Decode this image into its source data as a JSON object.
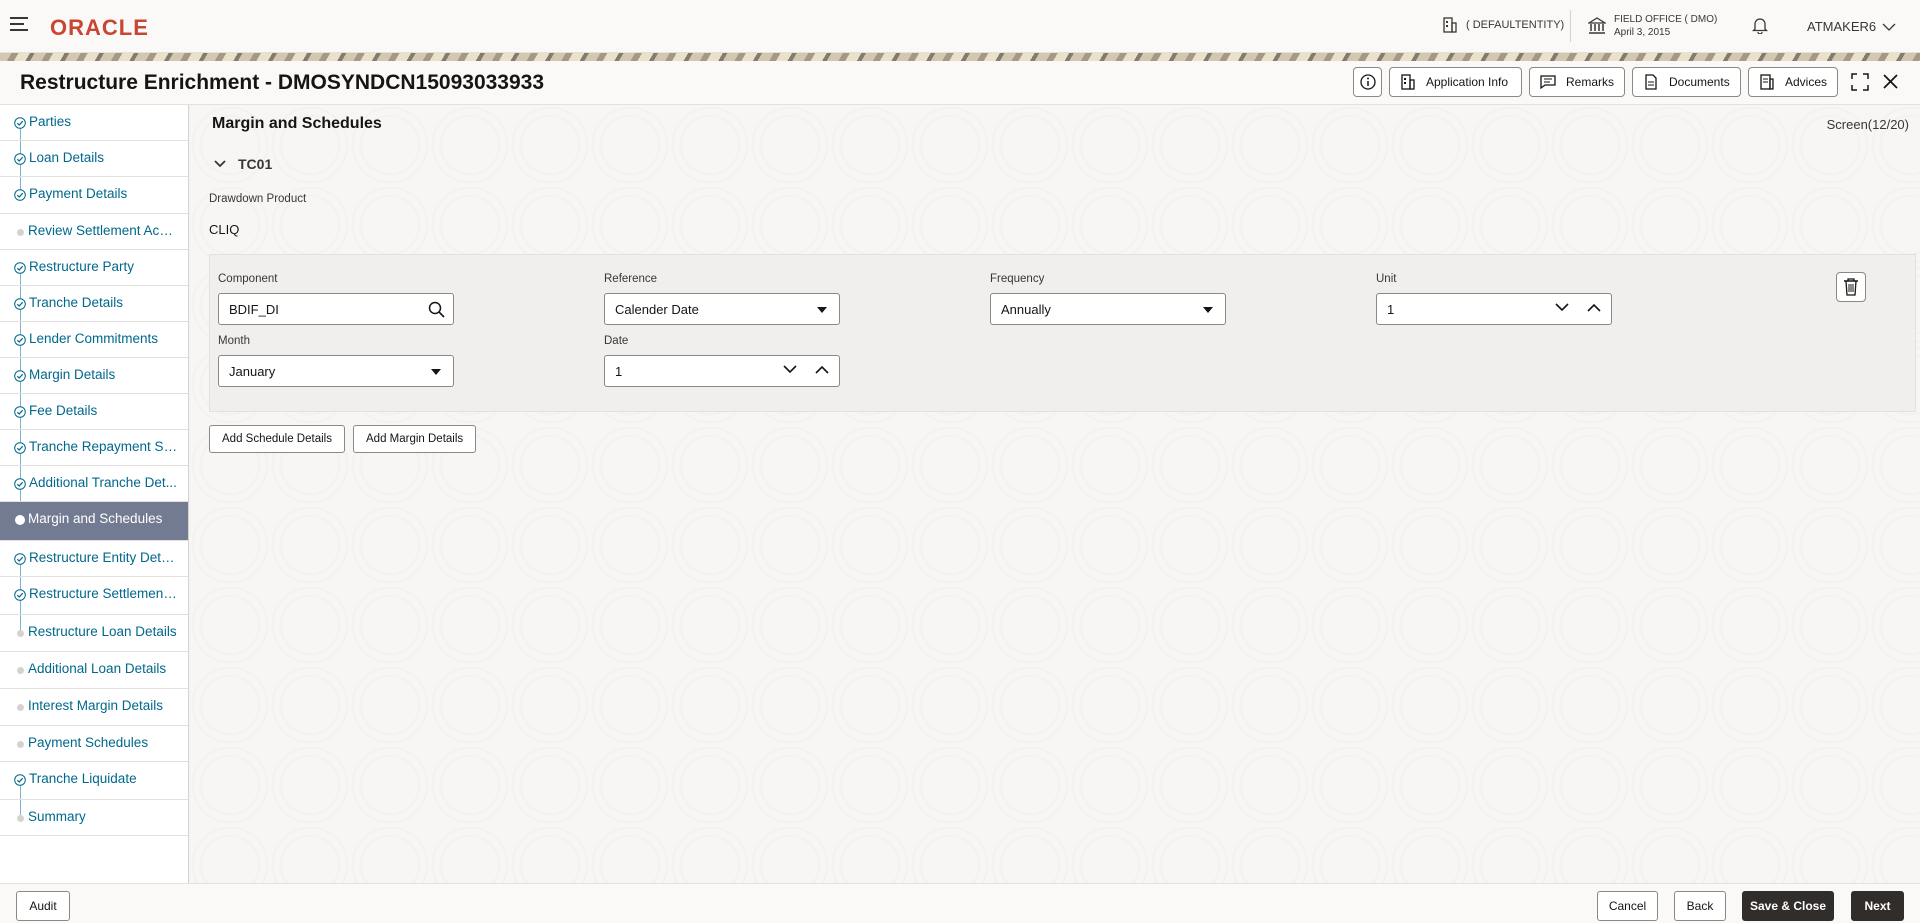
{
  "header": {
    "logo": "ORACLE",
    "entity": "( DEFAULTENTITY)",
    "office_name": "FIELD OFFICE ( DMO)",
    "office_date": "April 3, 2015",
    "user": "ATMAKER6"
  },
  "title": "Restructure Enrichment - DMOSYNDCN15093033933",
  "toolbar": {
    "application_info": "Application Info",
    "remarks": "Remarks",
    "documents": "Documents",
    "advices": "Advices"
  },
  "sidebar": {
    "items": [
      {
        "label": "Parties",
        "state": "done"
      },
      {
        "label": "Loan Details",
        "state": "done"
      },
      {
        "label": "Payment Details",
        "state": "done"
      },
      {
        "label": "Review Settlement Acco...",
        "state": "pending"
      },
      {
        "label": "Restructure Party",
        "state": "done"
      },
      {
        "label": "Tranche Details",
        "state": "done"
      },
      {
        "label": "Lender Commitments",
        "state": "done"
      },
      {
        "label": "Margin Details",
        "state": "done"
      },
      {
        "label": "Fee Details",
        "state": "done"
      },
      {
        "label": "Tranche Repayment Sc...",
        "state": "done"
      },
      {
        "label": "Additional Tranche Det...",
        "state": "done"
      },
      {
        "label": "Margin and Schedules",
        "state": "active"
      },
      {
        "label": "Restructure Entity Details",
        "state": "done"
      },
      {
        "label": "Restructure Settlement ...",
        "state": "done"
      },
      {
        "label": "Restructure Loan Details",
        "state": "pending"
      },
      {
        "label": "Additional Loan Details",
        "state": "pending"
      },
      {
        "label": "Interest Margin Details",
        "state": "pending"
      },
      {
        "label": "Payment Schedules",
        "state": "pending"
      },
      {
        "label": "Tranche Liquidate",
        "state": "done"
      },
      {
        "label": "Summary",
        "state": "pending"
      }
    ]
  },
  "main": {
    "section_title": "Margin and Schedules",
    "screen_count": "Screen(12/20)",
    "tranche": "TC01",
    "drawdown_label": "Drawdown Product",
    "drawdown_value": "CLIQ",
    "fields": {
      "component_label": "Component",
      "component_value": "BDIF_DI",
      "reference_label": "Reference",
      "reference_value": "Calender Date",
      "frequency_label": "Frequency",
      "frequency_value": "Annually",
      "unit_label": "Unit",
      "unit_value": "1",
      "month_label": "Month",
      "month_value": "January",
      "date_label": "Date",
      "date_value": "1"
    },
    "add_schedule": "Add Schedule Details",
    "add_margin": "Add Margin Details"
  },
  "footer": {
    "audit": "Audit",
    "cancel": "Cancel",
    "back": "Back",
    "save_close": "Save & Close",
    "next": "Next"
  }
}
